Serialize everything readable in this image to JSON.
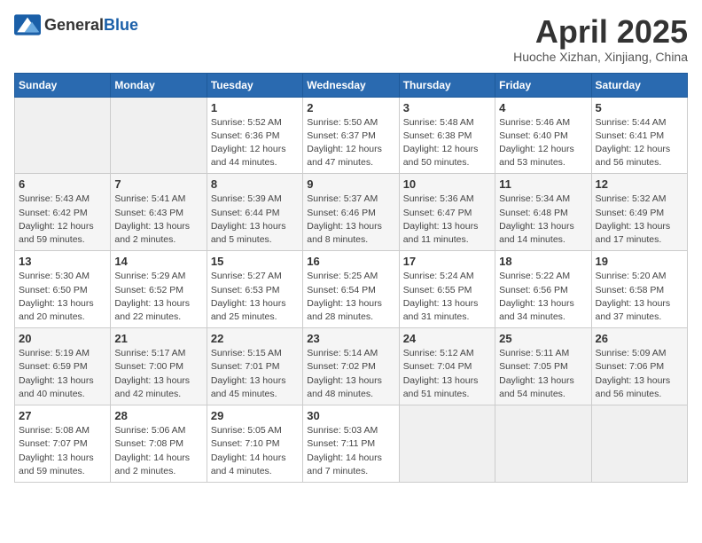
{
  "logo": {
    "text_general": "General",
    "text_blue": "Blue"
  },
  "title": "April 2025",
  "subtitle": "Huoche Xizhan, Xinjiang, China",
  "days_of_week": [
    "Sunday",
    "Monday",
    "Tuesday",
    "Wednesday",
    "Thursday",
    "Friday",
    "Saturday"
  ],
  "weeks": [
    [
      {
        "day": "",
        "empty": true
      },
      {
        "day": "",
        "empty": true
      },
      {
        "day": "1",
        "sunrise": "Sunrise: 5:52 AM",
        "sunset": "Sunset: 6:36 PM",
        "daylight": "Daylight: 12 hours and 44 minutes."
      },
      {
        "day": "2",
        "sunrise": "Sunrise: 5:50 AM",
        "sunset": "Sunset: 6:37 PM",
        "daylight": "Daylight: 12 hours and 47 minutes."
      },
      {
        "day": "3",
        "sunrise": "Sunrise: 5:48 AM",
        "sunset": "Sunset: 6:38 PM",
        "daylight": "Daylight: 12 hours and 50 minutes."
      },
      {
        "day": "4",
        "sunrise": "Sunrise: 5:46 AM",
        "sunset": "Sunset: 6:40 PM",
        "daylight": "Daylight: 12 hours and 53 minutes."
      },
      {
        "day": "5",
        "sunrise": "Sunrise: 5:44 AM",
        "sunset": "Sunset: 6:41 PM",
        "daylight": "Daylight: 12 hours and 56 minutes."
      }
    ],
    [
      {
        "day": "6",
        "sunrise": "Sunrise: 5:43 AM",
        "sunset": "Sunset: 6:42 PM",
        "daylight": "Daylight: 12 hours and 59 minutes."
      },
      {
        "day": "7",
        "sunrise": "Sunrise: 5:41 AM",
        "sunset": "Sunset: 6:43 PM",
        "daylight": "Daylight: 13 hours and 2 minutes."
      },
      {
        "day": "8",
        "sunrise": "Sunrise: 5:39 AM",
        "sunset": "Sunset: 6:44 PM",
        "daylight": "Daylight: 13 hours and 5 minutes."
      },
      {
        "day": "9",
        "sunrise": "Sunrise: 5:37 AM",
        "sunset": "Sunset: 6:46 PM",
        "daylight": "Daylight: 13 hours and 8 minutes."
      },
      {
        "day": "10",
        "sunrise": "Sunrise: 5:36 AM",
        "sunset": "Sunset: 6:47 PM",
        "daylight": "Daylight: 13 hours and 11 minutes."
      },
      {
        "day": "11",
        "sunrise": "Sunrise: 5:34 AM",
        "sunset": "Sunset: 6:48 PM",
        "daylight": "Daylight: 13 hours and 14 minutes."
      },
      {
        "day": "12",
        "sunrise": "Sunrise: 5:32 AM",
        "sunset": "Sunset: 6:49 PM",
        "daylight": "Daylight: 13 hours and 17 minutes."
      }
    ],
    [
      {
        "day": "13",
        "sunrise": "Sunrise: 5:30 AM",
        "sunset": "Sunset: 6:50 PM",
        "daylight": "Daylight: 13 hours and 20 minutes."
      },
      {
        "day": "14",
        "sunrise": "Sunrise: 5:29 AM",
        "sunset": "Sunset: 6:52 PM",
        "daylight": "Daylight: 13 hours and 22 minutes."
      },
      {
        "day": "15",
        "sunrise": "Sunrise: 5:27 AM",
        "sunset": "Sunset: 6:53 PM",
        "daylight": "Daylight: 13 hours and 25 minutes."
      },
      {
        "day": "16",
        "sunrise": "Sunrise: 5:25 AM",
        "sunset": "Sunset: 6:54 PM",
        "daylight": "Daylight: 13 hours and 28 minutes."
      },
      {
        "day": "17",
        "sunrise": "Sunrise: 5:24 AM",
        "sunset": "Sunset: 6:55 PM",
        "daylight": "Daylight: 13 hours and 31 minutes."
      },
      {
        "day": "18",
        "sunrise": "Sunrise: 5:22 AM",
        "sunset": "Sunset: 6:56 PM",
        "daylight": "Daylight: 13 hours and 34 minutes."
      },
      {
        "day": "19",
        "sunrise": "Sunrise: 5:20 AM",
        "sunset": "Sunset: 6:58 PM",
        "daylight": "Daylight: 13 hours and 37 minutes."
      }
    ],
    [
      {
        "day": "20",
        "sunrise": "Sunrise: 5:19 AM",
        "sunset": "Sunset: 6:59 PM",
        "daylight": "Daylight: 13 hours and 40 minutes."
      },
      {
        "day": "21",
        "sunrise": "Sunrise: 5:17 AM",
        "sunset": "Sunset: 7:00 PM",
        "daylight": "Daylight: 13 hours and 42 minutes."
      },
      {
        "day": "22",
        "sunrise": "Sunrise: 5:15 AM",
        "sunset": "Sunset: 7:01 PM",
        "daylight": "Daylight: 13 hours and 45 minutes."
      },
      {
        "day": "23",
        "sunrise": "Sunrise: 5:14 AM",
        "sunset": "Sunset: 7:02 PM",
        "daylight": "Daylight: 13 hours and 48 minutes."
      },
      {
        "day": "24",
        "sunrise": "Sunrise: 5:12 AM",
        "sunset": "Sunset: 7:04 PM",
        "daylight": "Daylight: 13 hours and 51 minutes."
      },
      {
        "day": "25",
        "sunrise": "Sunrise: 5:11 AM",
        "sunset": "Sunset: 7:05 PM",
        "daylight": "Daylight: 13 hours and 54 minutes."
      },
      {
        "day": "26",
        "sunrise": "Sunrise: 5:09 AM",
        "sunset": "Sunset: 7:06 PM",
        "daylight": "Daylight: 13 hours and 56 minutes."
      }
    ],
    [
      {
        "day": "27",
        "sunrise": "Sunrise: 5:08 AM",
        "sunset": "Sunset: 7:07 PM",
        "daylight": "Daylight: 13 hours and 59 minutes."
      },
      {
        "day": "28",
        "sunrise": "Sunrise: 5:06 AM",
        "sunset": "Sunset: 7:08 PM",
        "daylight": "Daylight: 14 hours and 2 minutes."
      },
      {
        "day": "29",
        "sunrise": "Sunrise: 5:05 AM",
        "sunset": "Sunset: 7:10 PM",
        "daylight": "Daylight: 14 hours and 4 minutes."
      },
      {
        "day": "30",
        "sunrise": "Sunrise: 5:03 AM",
        "sunset": "Sunset: 7:11 PM",
        "daylight": "Daylight: 14 hours and 7 minutes."
      },
      {
        "day": "",
        "empty": true
      },
      {
        "day": "",
        "empty": true
      },
      {
        "day": "",
        "empty": true
      }
    ]
  ]
}
